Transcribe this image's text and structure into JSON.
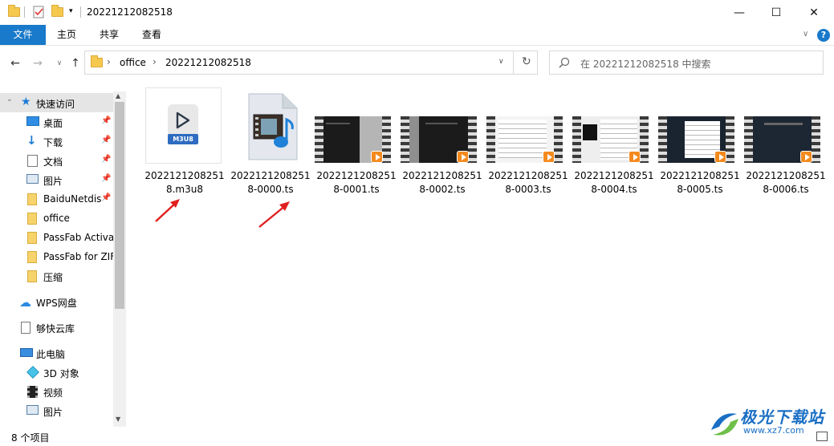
{
  "window": {
    "title": "20221212082518",
    "minimize": "—",
    "maximize": "☐",
    "close": "✕"
  },
  "ribbon": {
    "tabs": [
      "文件",
      "主页",
      "共享",
      "查看"
    ],
    "help": "?"
  },
  "address": {
    "segments": [
      "office",
      "20221212082518"
    ],
    "search_placeholder": "在 20221212082518 中搜索"
  },
  "sidebar": {
    "quick_access": "快速访问",
    "items": [
      "桌面",
      "下载",
      "文档",
      "图片",
      "BaiduNetdis",
      "office",
      "PassFab Activat",
      "PassFab for ZIF",
      "压缩"
    ],
    "wps": "WPS网盘",
    "cloud": "够快云库",
    "this_pc": "此电脑",
    "pc_items": [
      "3D 对象",
      "视频",
      "图片"
    ]
  },
  "files": [
    {
      "line1": "2022121208251",
      "line2": "8.m3u8",
      "badge": "M3U8"
    },
    {
      "line1": "2022121208251",
      "line2": "8-0000.ts"
    },
    {
      "line1": "2022121208251",
      "line2": "8-0001.ts"
    },
    {
      "line1": "2022121208251",
      "line2": "8-0002.ts"
    },
    {
      "line1": "2022121208251",
      "line2": "8-0003.ts"
    },
    {
      "line1": "2022121208251",
      "line2": "8-0004.ts"
    },
    {
      "line1": "2022121208251",
      "line2": "8-0005.ts"
    },
    {
      "line1": "2022121208251",
      "line2": "8-0006.ts"
    }
  ],
  "status": {
    "count": "8 个项目"
  },
  "watermark": {
    "name": "极光下载站",
    "url": "www.xz7.com"
  },
  "colors": {
    "accent": "#1979ca",
    "arrow": "#e0201f",
    "watermark_blue": "#1a6fc4"
  }
}
